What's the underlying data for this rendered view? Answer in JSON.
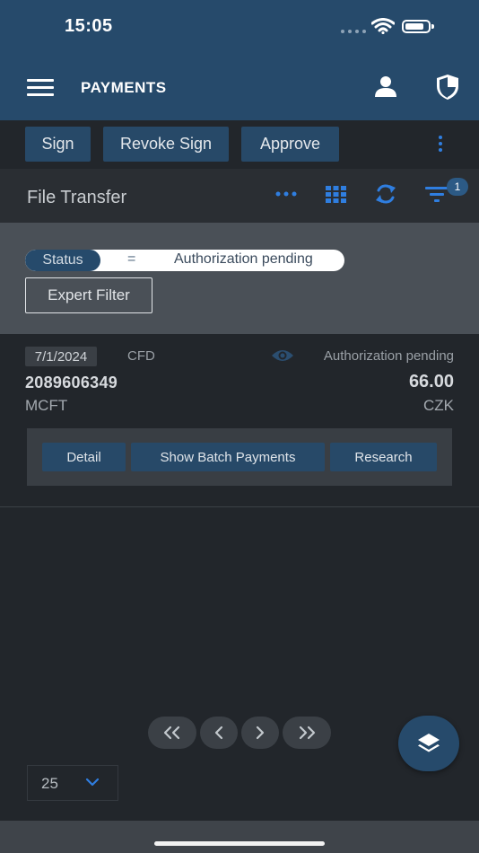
{
  "status_bar": {
    "time": "15:05"
  },
  "header": {
    "title": "PAYMENTS",
    "icons": [
      "menu-icon",
      "user-icon",
      "shield-icon"
    ]
  },
  "actions": {
    "sign": "Sign",
    "revoke_sign": "Revoke Sign",
    "approve": "Approve"
  },
  "toolbar": {
    "title": "File Transfer",
    "filter_count": "1",
    "icons": [
      "more-horizontal-icon",
      "grid-icon",
      "refresh-icon",
      "filter-icon"
    ]
  },
  "filter": {
    "key": "Status",
    "operator": "=",
    "value": "Authorization pending",
    "expert_label": "Expert Filter"
  },
  "item": {
    "date": "7/1/2024",
    "type_code": "CFD",
    "status": "Authorization pending",
    "id": "2089606349",
    "amount": "66.00",
    "payment_type": "MCFT",
    "currency": "CZK",
    "buttons": {
      "detail": "Detail",
      "show_batch": "Show Batch Payments",
      "research": "Research"
    }
  },
  "pagination": {
    "page_size": "25"
  },
  "colors": {
    "header_bg": "#264a6b",
    "accent": "#2f7ee0",
    "button_bg": "#274968",
    "background": "#22262b"
  }
}
